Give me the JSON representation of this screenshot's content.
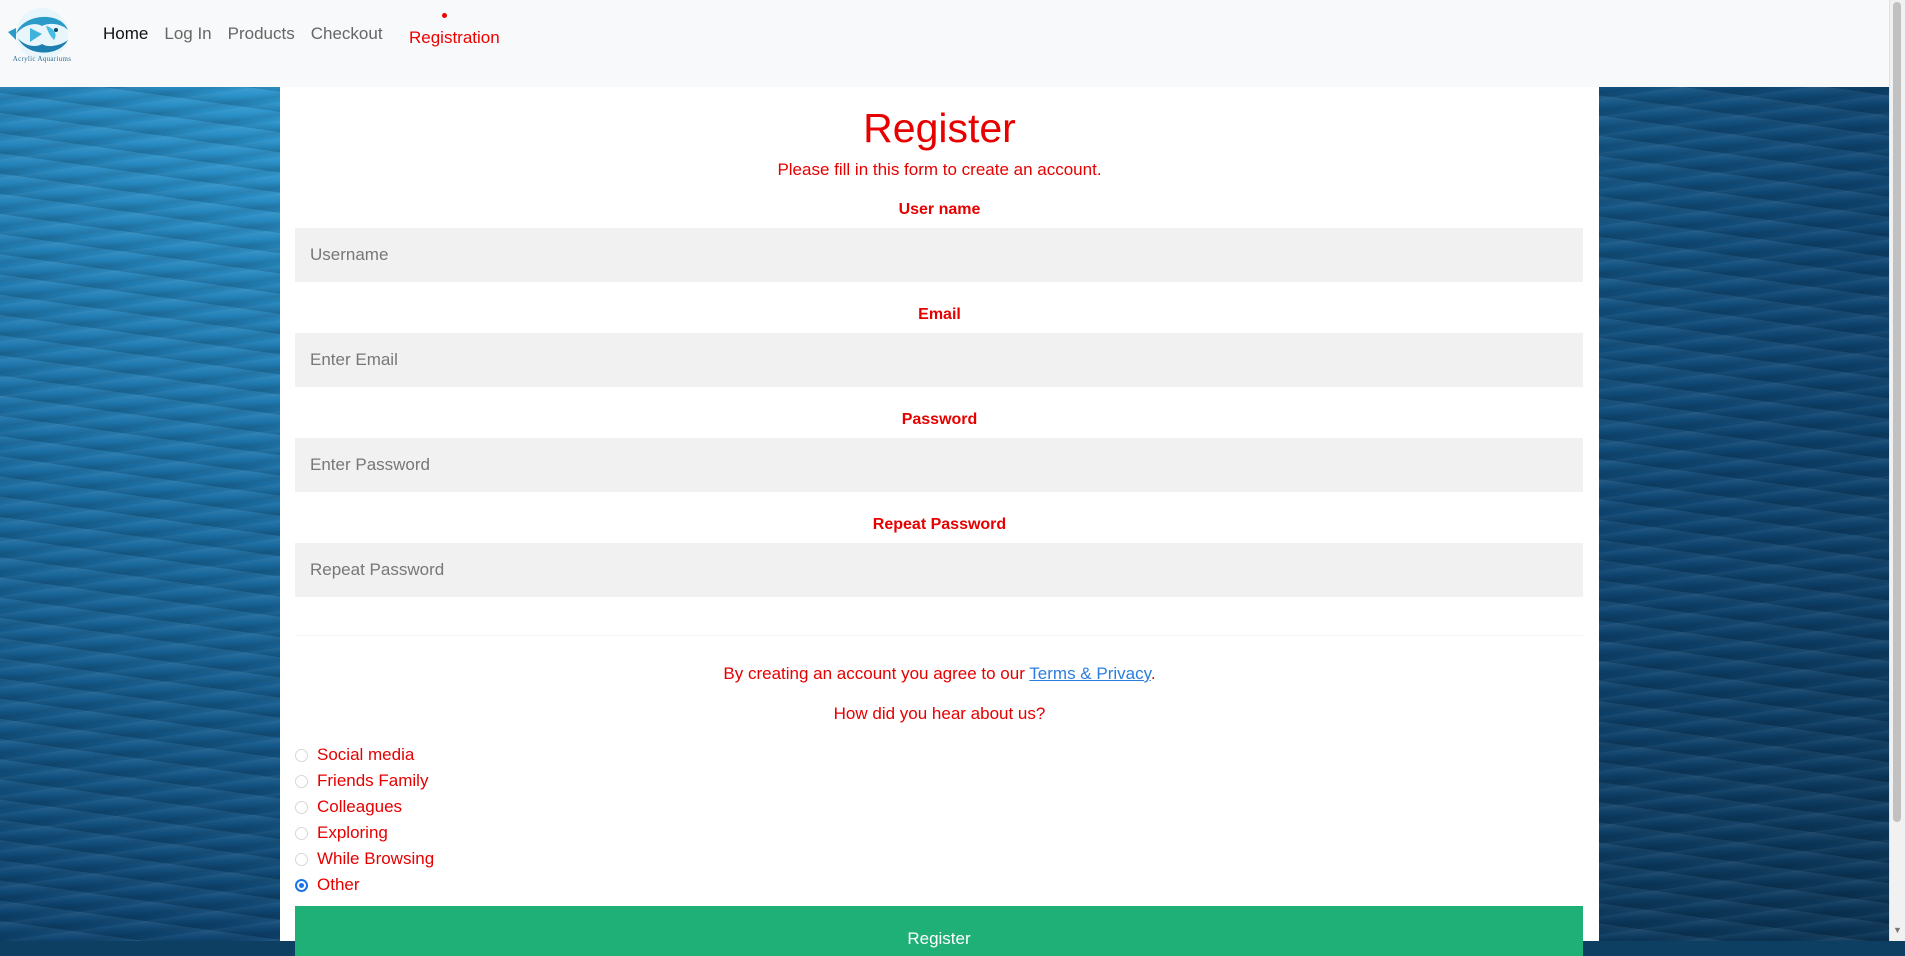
{
  "navbar": {
    "logo_text": "Acrylic Aquariums",
    "links": [
      {
        "label": "Home"
      },
      {
        "label": "Log In"
      },
      {
        "label": "Products"
      },
      {
        "label": "Checkout"
      }
    ],
    "current": "Registration"
  },
  "form": {
    "title": "Register",
    "subtitle": "Please fill in this form to create an account.",
    "fields": [
      {
        "label": "User name",
        "placeholder": "Username",
        "value": ""
      },
      {
        "label": "Email",
        "placeholder": "Enter Email",
        "value": ""
      },
      {
        "label": "Password",
        "placeholder": "Enter Password",
        "value": ""
      },
      {
        "label": "Repeat Password",
        "placeholder": "Repeat Password",
        "value": ""
      }
    ],
    "terms_prefix": "By creating an account you agree to our ",
    "terms_link": "Terms & Privacy",
    "terms_suffix": ".",
    "hear_question": "How did you hear about us?",
    "hear_options": [
      {
        "label": "Social media",
        "checked": false
      },
      {
        "label": "Friends Family",
        "checked": false
      },
      {
        "label": "Colleagues",
        "checked": false
      },
      {
        "label": "Exploring",
        "checked": false
      },
      {
        "label": "While Browsing",
        "checked": false
      },
      {
        "label": "Other",
        "checked": true
      }
    ],
    "submit_label": "Register"
  },
  "colors": {
    "accent_red": "#e60000",
    "submit_green": "#1eb077",
    "link_blue": "#2b7ee0"
  }
}
